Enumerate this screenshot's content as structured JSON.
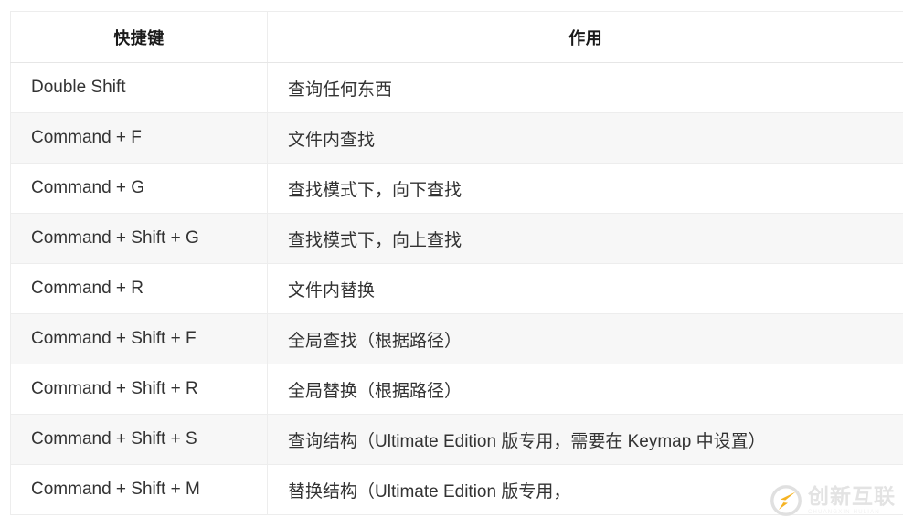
{
  "table": {
    "columns": [
      {
        "key": "shortcut",
        "header": "快捷键",
        "align": "center"
      },
      {
        "key": "action",
        "header": "作用",
        "align": "center"
      }
    ],
    "rows": [
      {
        "shortcut": "Double Shift",
        "action": "查询任何东西"
      },
      {
        "shortcut": "Command + F",
        "action": "文件内查找"
      },
      {
        "shortcut": "Command + G",
        "action": "查找模式下，向下查找"
      },
      {
        "shortcut": "Command + Shift + G",
        "action": "查找模式下，向上查找"
      },
      {
        "shortcut": "Command + R",
        "action": "文件内替换"
      },
      {
        "shortcut": "Command + Shift + F",
        "action": "全局查找（根据路径）"
      },
      {
        "shortcut": "Command + Shift + R",
        "action": "全局替换（根据路径）"
      },
      {
        "shortcut": "Command + Shift + S",
        "action": "查询结构（Ultimate Edition 版专用，需要在 Keymap 中设置）"
      },
      {
        "shortcut": "Command + Shift + M",
        "action": "替换结构（Ultimate Edition 版专用，"
      }
    ]
  },
  "watermark": {
    "title": "创新互联",
    "subtitle": "CHUANGXIN HULIAN",
    "logo_icon": "c-swoosh-logo-icon",
    "logo_color": "#f5b323",
    "text_color": "#e3e3e3"
  },
  "colors": {
    "row_stripe": "#f7f7f7",
    "row_base": "#ffffff",
    "border": "#ededed",
    "text": "#333333",
    "header_text": "#1a1a1a"
  }
}
